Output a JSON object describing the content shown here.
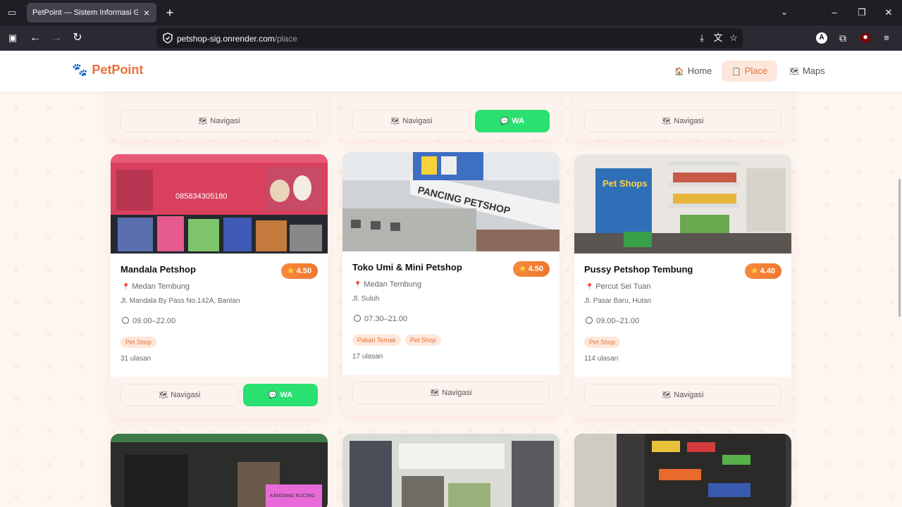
{
  "browser": {
    "tab_title": "PetPoint — Sistem Informasi Geografis",
    "url_host": "petshop-sig.onrender.com",
    "url_path": "/place"
  },
  "site": {
    "logo_text": "PetPoint",
    "menu": [
      {
        "label": "Home",
        "icon": "house-icon"
      },
      {
        "label": "Place",
        "icon": "clipboard-icon"
      },
      {
        "label": "Maps",
        "icon": "map-icon"
      }
    ],
    "accent_color": "#e8703a"
  },
  "buttons": {
    "navigate": "Navigasi",
    "whatsapp": "WA"
  },
  "cards": [
    {
      "name": "Mandala Petshop",
      "rating": "4.50",
      "area": "Medan Tembung",
      "address": "Jl. Mandala By Pass No.142A, Bantan",
      "hours": "09.00–22.00",
      "tags": [
        "Pet Shop"
      ],
      "reviews": "31 ulasan",
      "has_wa": true
    },
    {
      "name": "Toko Umi & Mini Petshop",
      "rating": "4.50",
      "area": "Medan Tembung",
      "address": "Jl. Suluh",
      "hours": "07.30–21.00",
      "tags": [
        "Pakan Ternak",
        "Pet Shop"
      ],
      "reviews": "17 ulasan",
      "has_wa": false
    },
    {
      "name": "Pussy Petshop Tembung",
      "rating": "4.40",
      "area": "Percut Sei Tuan",
      "address": "Jl. Pasar Baru, Hutan",
      "hours": "09.00–21.00",
      "tags": [
        "Pet Shop"
      ],
      "reviews": "114 ulasan",
      "has_wa": false
    }
  ],
  "photo_text": {
    "sign1_phone": "085834305180",
    "sign2": "PANCING PETSHOP",
    "sign3": "Pet Shops",
    "sign4": "KANDANG KUCING"
  }
}
